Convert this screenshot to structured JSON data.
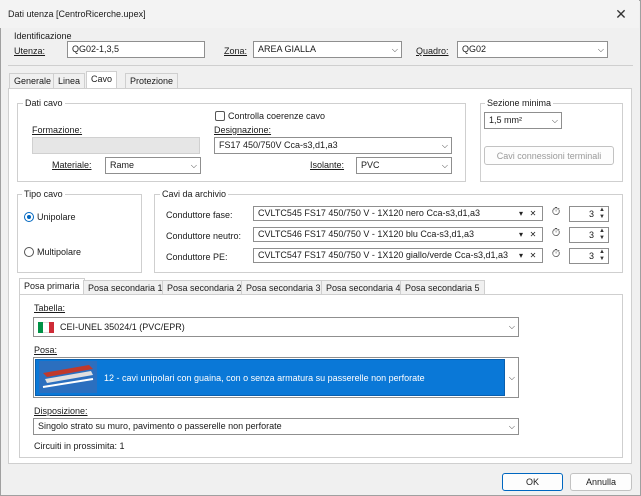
{
  "window": {
    "title": "Dati utenza [CentroRicerche.upex]"
  },
  "identificazione": {
    "group_label": "Identificazione",
    "utenza_label": "Utenza:",
    "utenza_value": "QG02-1,3,5",
    "zona_label": "Zona:",
    "zona_value": "AREA GIALLA",
    "quadro_label": "Quadro:",
    "quadro_value": "QG02"
  },
  "tabs": [
    "Generale",
    "Linea",
    "Cavo",
    "Protezione"
  ],
  "dati_cavo": {
    "group_label": "Dati cavo",
    "controlla_label": "Controlla coerenze cavo",
    "formazione_label": "Formazione:",
    "formazione_value": "",
    "designazione_label": "Designazione:",
    "designazione_value": "FS17 450/750V  Cca-s3,d1,a3",
    "materiale_label": "Materiale:",
    "materiale_value": "Rame",
    "isolante_label": "Isolante:",
    "isolante_value": "PVC"
  },
  "sezione_minima": {
    "group_label": "Sezione minima",
    "value": "1,5 mm²",
    "cavi_button": "Cavi connessioni terminali"
  },
  "tipo_cavo": {
    "group_label": "Tipo cavo",
    "unipolare": "Unipolare",
    "multipolare": "Multipolare"
  },
  "cavi_archivio": {
    "group_label": "Cavi da archivio",
    "rows": [
      {
        "label": "Conduttore fase:",
        "value": "CVLTC545 FS17 450/750 V - 1X120 nero Cca-s3,d1,a3",
        "count": "3"
      },
      {
        "label": "Conduttore neutro:",
        "value": "CVLTC546 FS17 450/750 V - 1X120 blu Cca-s3,d1,a3",
        "count": "3"
      },
      {
        "label": "Conduttore PE:",
        "value": "CVLTC547 FS17 450/750 V - 1X120 giallo/verde Cca-s3,d1,a3",
        "count": "3"
      }
    ]
  },
  "posa_tabs": [
    "Posa primaria",
    "Posa secondaria 1",
    "Posa secondaria 2",
    "Posa secondaria 3",
    "Posa secondaria 4",
    "Posa secondaria 5"
  ],
  "posa": {
    "tabella_label": "Tabella:",
    "tabella_value": "CEI-UNEL 35024/1 (PVC/EPR)",
    "posa_label": "Posa:",
    "posa_value": "12 - cavi unipolari con guaina, con o senza armatura su passerelle non perforate",
    "disposizione_label": "Disposizione:",
    "disposizione_value": "Singolo strato su muro, pavimento o passerelle non perforate",
    "circuiti": "Circuiti in prossimita: 1"
  },
  "footer": {
    "ok": "OK",
    "annulla": "Annulla"
  },
  "colors": {
    "accent": "#0067c0",
    "selection": "#0a78d7",
    "flag_green": "#009246",
    "flag_white": "#ffffff",
    "flag_red": "#ce2b37"
  }
}
